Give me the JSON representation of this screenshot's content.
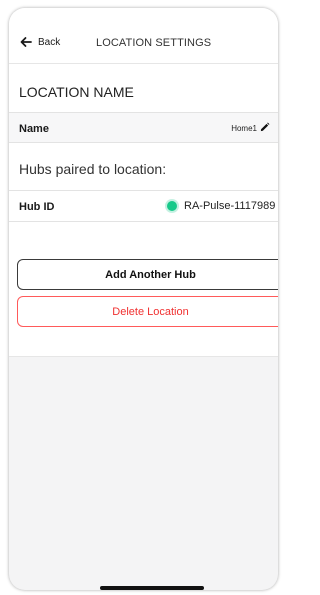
{
  "header": {
    "back_label": "Back",
    "title": "LOCATION SETTINGS"
  },
  "section": {
    "location_name_title": "LOCATION NAME",
    "hubs_title": "Hubs paired to location:"
  },
  "name_row": {
    "label": "Name",
    "value": "Home1",
    "edit_icon": "pencil-icon"
  },
  "hub_row": {
    "label": "Hub ID",
    "value": "RA-Pulse-1117989",
    "status_color": "#17c98a"
  },
  "buttons": {
    "add_hub": "Add Another Hub",
    "delete_location": "Delete Location"
  },
  "colors": {
    "danger": "#f03030",
    "status_online": "#17c98a"
  }
}
